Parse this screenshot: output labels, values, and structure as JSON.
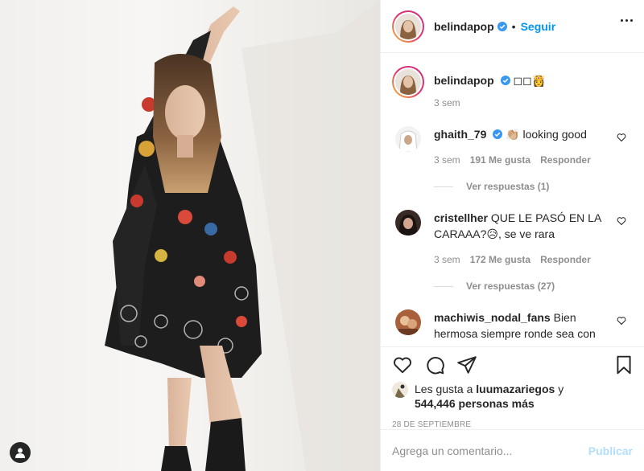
{
  "header": {
    "username": "belindapop",
    "follow_label": "Seguir",
    "separator": "•"
  },
  "caption": {
    "username": "belindapop",
    "text": "◻◻👸",
    "time": "3 sem"
  },
  "comments": [
    {
      "username": "ghaith_79",
      "text": "👏🏼 looking good",
      "time": "3 sem",
      "likes": "191 Me gusta",
      "reply_label": "Responder",
      "replies": "Ver respuestas (1)"
    },
    {
      "username": "cristellher",
      "text": "QUE LE PASÓ EN LA CARAAA?😥, se ve rara",
      "time": "3 sem",
      "likes": "172 Me gusta",
      "reply_label": "Responder",
      "replies": "Ver respuestas (27)"
    },
    {
      "username": "machiwis_nodal_fans",
      "text": "Bien hermosa siempre ronde sea con",
      "time": "",
      "likes": "",
      "reply_label": "",
      "replies": ""
    }
  ],
  "likes": {
    "prefix": "Les gusta a",
    "user": "luumazariegos",
    "joiner": "y",
    "count": "544,446 personas más"
  },
  "date": "28 DE SEPTIEMBRE",
  "comment_box": {
    "placeholder": "Agrega un comentario...",
    "publish_label": "Publicar"
  },
  "colors": {
    "link_blue": "#0095f6",
    "publish_disabled": "#b2dffc",
    "muted": "#8e8e8e",
    "text": "#262626"
  },
  "icons": [
    "heart-icon",
    "comment-icon",
    "share-icon",
    "bookmark-icon",
    "more-options-icon",
    "verified-badge-icon",
    "user-tag-icon"
  ]
}
